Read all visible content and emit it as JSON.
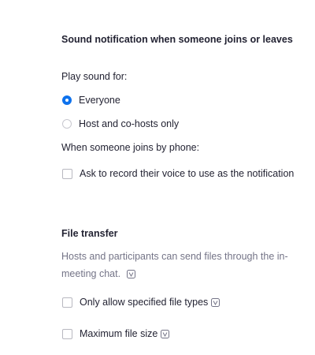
{
  "sound_notification": {
    "title": "Sound notification when someone joins or leaves",
    "play_sound_label": "Play sound for:",
    "options": [
      {
        "label": "Everyone",
        "selected": true
      },
      {
        "label": "Host and co-hosts only",
        "selected": false
      }
    ],
    "phone_label": "When someone joins by phone:",
    "record_voice_label": "Ask to record their voice to use as the notification",
    "record_voice_checked": false
  },
  "file_transfer": {
    "title": "File transfer",
    "description_line1": "Hosts and participants can send files through the in-",
    "description_line2": "meeting chat.",
    "only_specified_label": "Only allow specified file types",
    "only_specified_checked": false,
    "max_size_label": "Maximum file size",
    "max_size_checked": false
  },
  "colors": {
    "accent": "#0e72ed",
    "text": "#232333",
    "muted": "#747487"
  },
  "icons": {
    "info": "info-verified-icon"
  }
}
